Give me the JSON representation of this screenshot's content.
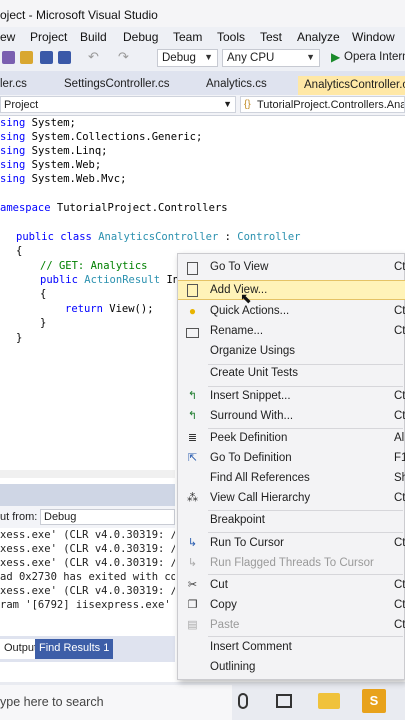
{
  "window": {
    "title": "oject - Microsoft Visual Studio"
  },
  "menu": [
    "ew",
    "Project",
    "Build",
    "Debug",
    "Team",
    "Tools",
    "Test",
    "Analyze",
    "Window"
  ],
  "toolbar": {
    "config": "Debug",
    "platform": "Any CPU",
    "run": "Opera Intern"
  },
  "tabs": [
    "ler.cs",
    "SettingsController.cs",
    "Analytics.cs",
    "AnalyticsController.cs"
  ],
  "navbar": {
    "project": "Project",
    "scope": "TutorialProject.Controllers.Ana"
  },
  "code": {
    "lines": [
      {
        "k": "sing",
        "r": " System;"
      },
      {
        "k": "sing",
        "r": " System.Collections.Generic;"
      },
      {
        "k": "sing",
        "r": " System.Linq;"
      },
      {
        "k": "sing",
        "r": " System.Web;"
      },
      {
        "k": "sing",
        "r": " System.Web.Mvc;"
      }
    ],
    "ns_kw": "amespace",
    "ns_name": " TutorialProject.Controllers",
    "public": "public",
    "class": "class",
    "class_name": "AnalyticsController",
    "colon": " : ",
    "base": "Controller",
    "brace_open": "{",
    "brace_close": "}",
    "comment": "// GET: Analytics",
    "action_result": "ActionResult",
    "action_name": " In",
    "return_kw": "return",
    "return_rest": " View();"
  },
  "output": {
    "from_label": "ut from:",
    "from_value": "Debug",
    "lines": [
      "xess.exe' (CLR v4.0.30319: /L",
      "xess.exe' (CLR v4.0.30319: /L",
      "xess.exe' (CLR v4.0.30319: /L",
      "ad 0x2730 has exited with co",
      "xess.exe' (CLR v4.0.30319: /L",
      "ram '[6792] iisexpress.exe'"
    ],
    "tab_output": "Output",
    "tab_find": "Find Results 1"
  },
  "taskbar": {
    "search_placeholder": "ype here to search"
  },
  "context_menu": {
    "items": [
      {
        "label": "Go To View",
        "shortcut": "Ct",
        "icon": "go-to-view-icon"
      },
      {
        "label": "Add View...",
        "shortcut": "",
        "icon": "add-view-icon"
      },
      {
        "label": "Quick Actions...",
        "shortcut": "Ct",
        "icon": "lightbulb-icon"
      },
      {
        "label": "Rename...",
        "shortcut": "Ct",
        "icon": "rename-icon"
      },
      {
        "label": "Organize Usings",
        "shortcut": "",
        "icon": ""
      },
      {
        "label": "Create Unit Tests",
        "shortcut": "",
        "icon": ""
      },
      {
        "label": "Insert Snippet...",
        "shortcut": "Ct",
        "icon": "insert-snippet-icon"
      },
      {
        "label": "Surround With...",
        "shortcut": "Ct",
        "icon": "surround-with-icon"
      },
      {
        "label": "Peek Definition",
        "shortcut": "Al",
        "icon": "peek-definition-icon"
      },
      {
        "label": "Go To Definition",
        "shortcut": "F1",
        "icon": "go-to-definition-icon"
      },
      {
        "label": "Find All References",
        "shortcut": "Sh",
        "icon": ""
      },
      {
        "label": "View Call Hierarchy",
        "shortcut": "Ct",
        "icon": "call-hierarchy-icon"
      },
      {
        "label": "Breakpoint",
        "shortcut": "",
        "icon": ""
      },
      {
        "label": "Run To Cursor",
        "shortcut": "Ct",
        "icon": "run-to-cursor-icon"
      },
      {
        "label": "Run Flagged Threads To Cursor",
        "shortcut": "",
        "icon": "run-flagged-threads-icon"
      },
      {
        "label": "Cut",
        "shortcut": "Ct",
        "icon": "cut-icon"
      },
      {
        "label": "Copy",
        "shortcut": "Ct",
        "icon": "copy-icon"
      },
      {
        "label": "Paste",
        "shortcut": "Ct",
        "icon": "paste-icon"
      },
      {
        "label": "Insert Comment",
        "shortcut": "",
        "icon": ""
      },
      {
        "label": "Outlining",
        "shortcut": "",
        "icon": ""
      }
    ]
  }
}
